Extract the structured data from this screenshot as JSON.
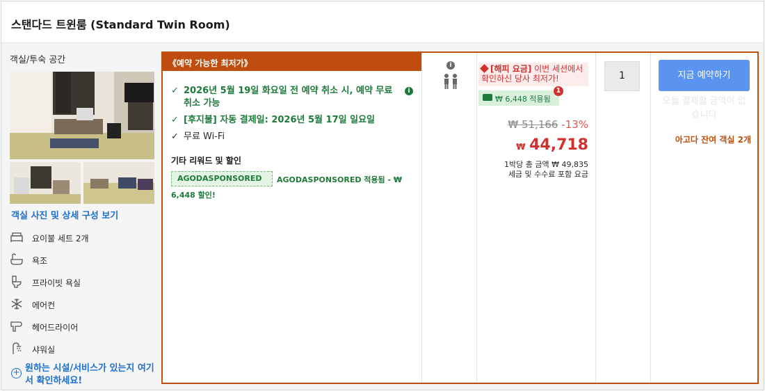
{
  "room": {
    "title": "스탠다드 트윈룸 (Standard Twin Room)"
  },
  "sidebar": {
    "label": "객실/투숙 공간",
    "photo_link": "객실 사진 및 상세 구성 보기",
    "amenities": [
      {
        "icon": "bed-icon",
        "label": "요이불 세트 2개"
      },
      {
        "icon": "bathtub-icon",
        "label": "욕조"
      },
      {
        "icon": "toilet-icon",
        "label": "프라이빗 욕실"
      },
      {
        "icon": "snowflake-icon",
        "label": "에어컨"
      },
      {
        "icon": "hairdryer-icon",
        "label": "헤어드라이어"
      },
      {
        "icon": "shower-icon",
        "label": "샤워실"
      }
    ],
    "facility_link": "원하는 시설/서비스가 있는지 여기서 확인하세요!"
  },
  "offer": {
    "badge": "《예약 가능한 최저가》",
    "conditions": [
      "2026년 5월 19일 화요일 전 예약 취소 시, 예약 무료 취소 가능",
      "[후지불] 자동 결제일: 2026년 5월 17일 일요일",
      "무료 Wi-Fi"
    ],
    "promo_heading": "기타 리워드 및 할인",
    "coupon_code": "AGODASPONSORED",
    "coupon_note": "AGODASPONSORED 적용됨 - ₩ 6,448 할인!"
  },
  "price": {
    "happy_label": "[해피 요금]",
    "happy_text": "이번 세션에서 확인하신 당사 최저가!",
    "applied": "₩ 6,448 적용됨",
    "alert_count": "1",
    "old_price": "₩ 51,166",
    "discount": "-13%",
    "currency": "₩",
    "amount": "44,718",
    "per_night_line1": "1박당 총 금액 ₩ 49,835",
    "per_night_line2": "세금 및 수수료 포함 요금"
  },
  "booking": {
    "quantity": "1",
    "button": "지금 예약하기",
    "no_payment": "오늘 결제할 금액이 없습니다",
    "rooms_left": "아고다 잔여 객실 2개"
  },
  "colors": {
    "accent": "#c04d10",
    "link": "#1a6fd1",
    "green": "#1e7a3b",
    "price_red": "#d0312d",
    "button_blue": "#5a94f0"
  }
}
